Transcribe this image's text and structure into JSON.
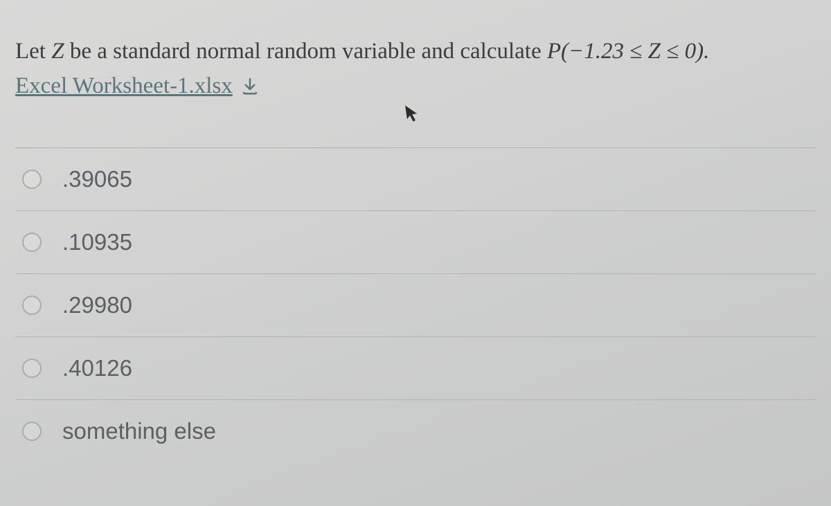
{
  "question": {
    "pre": "Let ",
    "var": "Z",
    "mid": " be a standard normal random variable and calculate ",
    "expr_pre": "P(−1.23 ≤ ",
    "expr_var": "Z",
    "expr_post": " ≤ 0)."
  },
  "attachment": {
    "label": "Excel Worksheet-1.xlsx",
    "icon": "download-icon"
  },
  "options": [
    {
      "label": ".39065"
    },
    {
      "label": ".10935"
    },
    {
      "label": ".29980"
    },
    {
      "label": ".40126"
    },
    {
      "label": "something else"
    }
  ]
}
